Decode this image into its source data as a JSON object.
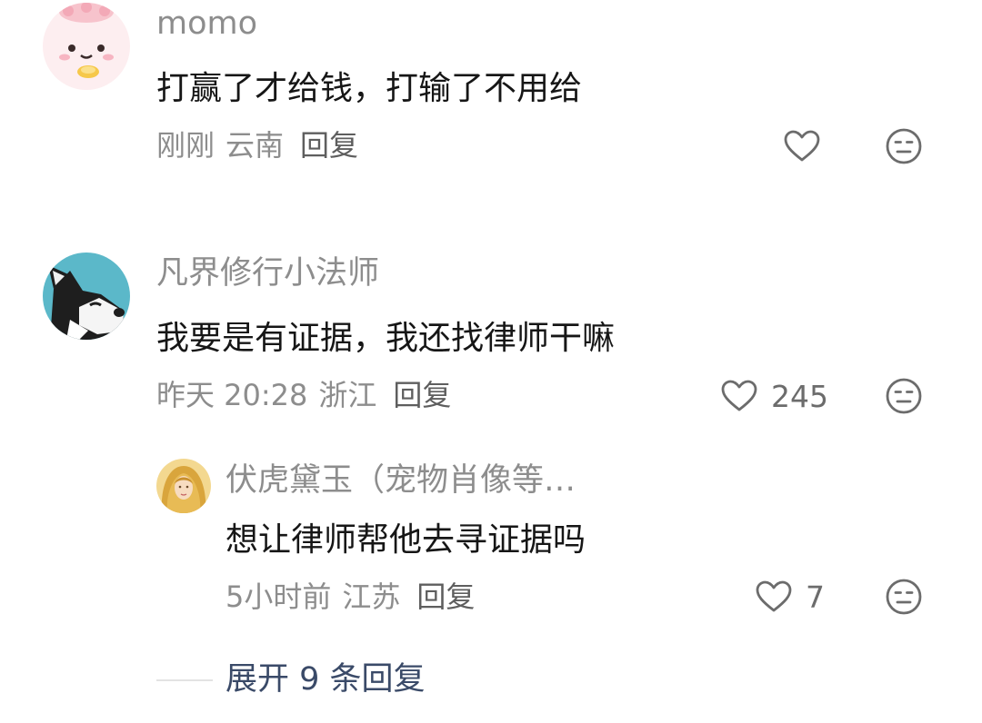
{
  "comments": [
    {
      "username": "momo",
      "content": "打赢了才给钱，打输了不用给",
      "time": "刚刚",
      "location": "云南",
      "reply_label": "回复",
      "likes": "",
      "avatar_icon": "pink-bun-avatar-icon"
    },
    {
      "username": "凡界修行小法师",
      "content": "我要是有证据，我还找律师干嘛",
      "time": "昨天 20:28",
      "location": "浙江",
      "reply_label": "回复",
      "likes": "245",
      "avatar_icon": "husky-dog-avatar-icon",
      "replies": [
        {
          "username": "伏虎黛玉（宠物肖像等…",
          "content": "想让律师帮他去寻证据吗",
          "time": "5小时前",
          "location": "江苏",
          "reply_label": "回复",
          "likes": "7",
          "avatar_icon": "golden-hair-girl-avatar-icon"
        }
      ],
      "expand_label": "展开 9 条回复"
    }
  ],
  "icons": {
    "like": "heart-outline-icon",
    "dislike": "meh-face-icon"
  },
  "colors": {
    "username": "#8d8d8d",
    "content": "#161616",
    "meta": "#8d8d8d",
    "expand": "#3a4a68",
    "icon": "#6c6c6c"
  }
}
